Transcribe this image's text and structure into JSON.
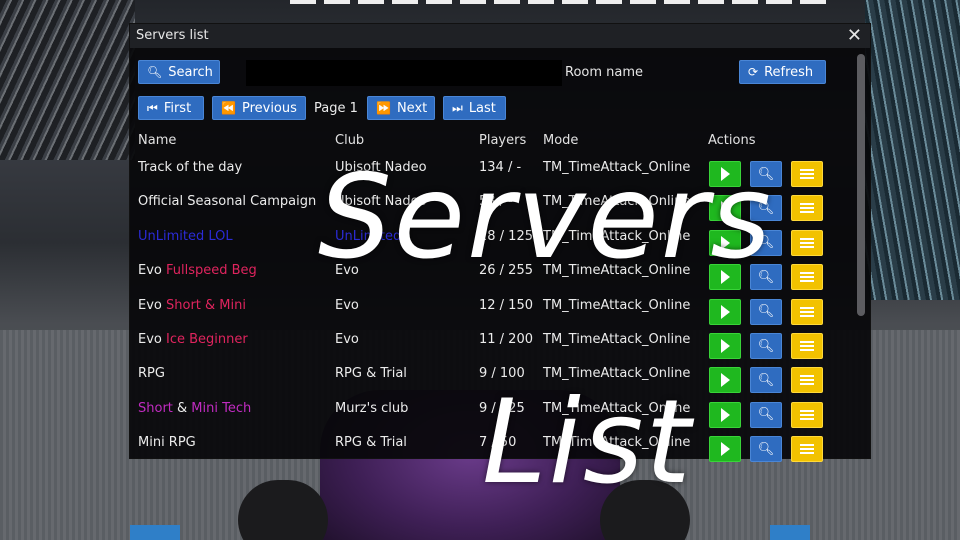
{
  "window": {
    "title": "Servers list",
    "close_icon": "close-icon"
  },
  "toolbar": {
    "search_label": "Search",
    "search_value": "",
    "room_name_label": "Room name",
    "refresh_label": "Refresh"
  },
  "pagination": {
    "first_label": "First",
    "previous_label": "Previous",
    "page_label": "Page 1",
    "next_label": "Next",
    "last_label": "Last"
  },
  "columns": [
    "Name",
    "Club",
    "Players",
    "Mode",
    "Actions"
  ],
  "rows": [
    {
      "name": [
        {
          "text": "Track of the day",
          "color": "#ececec"
        }
      ],
      "club": "Ubisoft Nadeo",
      "players": "134 / -",
      "mode": "TM_TimeAttack_Online"
    },
    {
      "name": [
        {
          "text": "Official Seasonal Campaign",
          "color": "#ececec"
        }
      ],
      "club": "Ubisoft Nadeo",
      "players": "53 / -",
      "mode": "TM_TimeAttack_Online"
    },
    {
      "name": [
        {
          "text": "UnLimited LOL",
          "color": "#2b2bd6"
        }
      ],
      "club": "UnLimited",
      "club_color": "#2b2bd6",
      "players": "28 / 125",
      "mode": "TM_TimeAttack_Online"
    },
    {
      "name": [
        {
          "text": "Evo ",
          "color": "#ececec"
        },
        {
          "text": "Fullspeed Beg",
          "color": "#e0245e"
        }
      ],
      "club": "Evo",
      "players": "26 / 255",
      "mode": "TM_TimeAttack_Online"
    },
    {
      "name": [
        {
          "text": "Evo ",
          "color": "#ececec"
        },
        {
          "text": "Short & Mini",
          "color": "#e0245e"
        }
      ],
      "club": "Evo",
      "players": "12 / 150",
      "mode": "TM_TimeAttack_Online"
    },
    {
      "name": [
        {
          "text": "Evo ",
          "color": "#ececec"
        },
        {
          "text": "Ice Beginner",
          "color": "#e0245e"
        }
      ],
      "club": "Evo",
      "players": "11 / 200",
      "mode": "TM_TimeAttack_Online"
    },
    {
      "name": [
        {
          "text": "RPG",
          "color": "#ececec"
        }
      ],
      "club": "RPG & Trial",
      "players": "9 / 100",
      "mode": "TM_TimeAttack_Online"
    },
    {
      "name": [
        {
          "text": "Short",
          "color": "#c02bc0"
        },
        {
          "text": " & ",
          "color": "#ececec"
        },
        {
          "text": "Mini Tech",
          "color": "#c02bc0"
        }
      ],
      "club": "Murz's club",
      "players": "9 / 225",
      "mode": "TM_TimeAttack_Online"
    },
    {
      "name": [
        {
          "text": "Mini RPG",
          "color": "#ececec"
        }
      ],
      "club": "RPG & Trial",
      "players": "7 / 50",
      "mode": "TM_TimeAttack_Online"
    }
  ],
  "actions": {
    "play_icon": "play-icon",
    "info_icon": "magnifier-icon",
    "list_icon": "list-icon"
  },
  "overlay": {
    "line1": "Servers",
    "line2": "List"
  },
  "colors": {
    "primary_button": "#2f6cc0",
    "play_button": "#1fb81f",
    "list_button": "#f2c200"
  }
}
